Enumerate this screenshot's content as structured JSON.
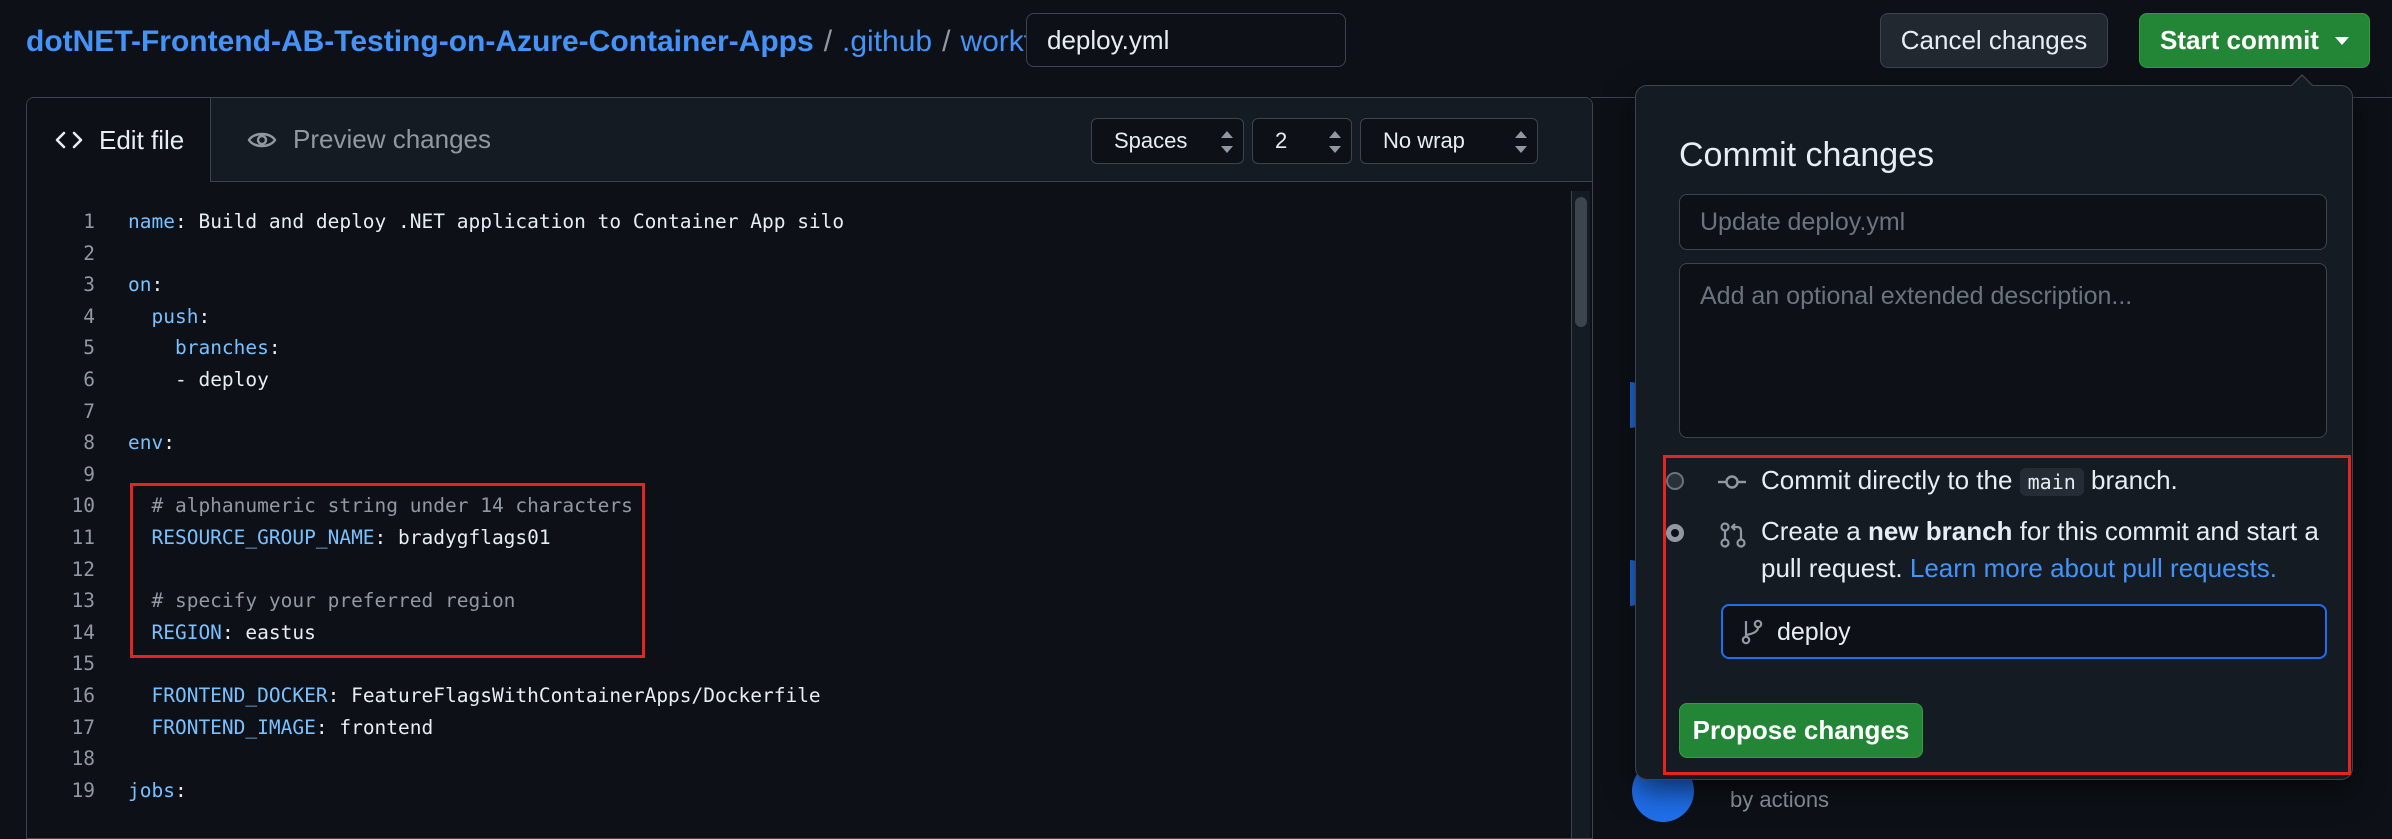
{
  "breadcrumb": {
    "repo": "dotNET-Frontend-AB-Testing-on-Azure-Container-Apps",
    "sep": "/",
    "folder1": ".github",
    "folder2": "workflows"
  },
  "filename": {
    "value": "deploy.yml"
  },
  "header": {
    "cancel_label": "Cancel changes",
    "start_commit_label": "Start commit"
  },
  "editor": {
    "tabs": {
      "edit": "Edit file",
      "preview": "Preview changes"
    },
    "indent_mode": "Spaces",
    "indent_size": "2",
    "wrap_mode": "No wrap",
    "lines": [
      {
        "n": "1",
        "key": "name",
        "rest": ": Build and deploy .NET application to Container App silo",
        "indent": "",
        "comment": "",
        "dash": ""
      },
      {
        "n": "2",
        "key": "",
        "rest": "",
        "indent": "",
        "comment": "",
        "dash": ""
      },
      {
        "n": "3",
        "key": "on",
        "rest": ":",
        "indent": "",
        "comment": "",
        "dash": ""
      },
      {
        "n": "4",
        "key": "push",
        "rest": ":",
        "indent": "  ",
        "comment": "",
        "dash": ""
      },
      {
        "n": "5",
        "key": "branches",
        "rest": ":",
        "indent": "    ",
        "comment": "",
        "dash": ""
      },
      {
        "n": "6",
        "key": "",
        "rest": "- deploy",
        "indent": "    ",
        "comment": "",
        "dash": ""
      },
      {
        "n": "7",
        "key": "",
        "rest": "",
        "indent": "",
        "comment": "",
        "dash": ""
      },
      {
        "n": "8",
        "key": "env",
        "rest": ":",
        "indent": "",
        "comment": "",
        "dash": ""
      },
      {
        "n": "9",
        "key": "",
        "rest": "",
        "indent": "",
        "comment": "",
        "dash": ""
      },
      {
        "n": "10",
        "key": "",
        "rest": "",
        "indent": "  ",
        "comment": "# alphanumeric string under 14 characters",
        "dash": ""
      },
      {
        "n": "11",
        "key": "RESOURCE_GROUP_NAME",
        "rest": ": bradygflags01",
        "indent": "  ",
        "comment": "",
        "dash": ""
      },
      {
        "n": "12",
        "key": "",
        "rest": "",
        "indent": "",
        "comment": "",
        "dash": ""
      },
      {
        "n": "13",
        "key": "",
        "rest": "",
        "indent": "  ",
        "comment": "# specify your preferred region",
        "dash": ""
      },
      {
        "n": "14",
        "key": "REGION",
        "rest": ": eastus",
        "indent": "  ",
        "comment": "",
        "dash": ""
      },
      {
        "n": "15",
        "key": "",
        "rest": "",
        "indent": "",
        "comment": "",
        "dash": ""
      },
      {
        "n": "16",
        "key": "FRONTEND_DOCKER",
        "rest": ": FeatureFlagsWithContainerApps/Dockerfile",
        "indent": "  ",
        "comment": "",
        "dash": ""
      },
      {
        "n": "17",
        "key": "FRONTEND_IMAGE",
        "rest": ": frontend",
        "indent": "  ",
        "comment": "",
        "dash": ""
      },
      {
        "n": "18",
        "key": "",
        "rest": "",
        "indent": "",
        "comment": "",
        "dash": ""
      },
      {
        "n": "19",
        "key": "jobs",
        "rest": ":",
        "indent": "",
        "comment": "",
        "dash": ""
      }
    ]
  },
  "commit_panel": {
    "title": "Commit changes",
    "summary_placeholder": "Update deploy.yml",
    "description_placeholder": "Add an optional extended description...",
    "option_direct": {
      "before": "Commit directly to the",
      "branch": "main",
      "after": "branch."
    },
    "option_new": {
      "before": "Create a",
      "bold": "new branch",
      "after": "for this commit and start a pull request.",
      "link": "Learn more about pull requests."
    },
    "selected_option": "new_branch",
    "branch_name": "deploy",
    "propose_label": "Propose changes"
  },
  "sidebar_remnant": {
    "by_actions": "by actions"
  },
  "colors": {
    "background": "#0d1117",
    "accent_green": "#238636",
    "link_blue": "#4493f8",
    "highlight_red": "#e5231f"
  }
}
